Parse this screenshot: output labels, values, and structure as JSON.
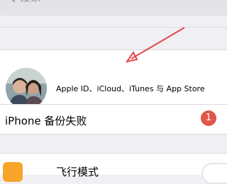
{
  "search": {
    "placeholder": "搜索"
  },
  "profile": {
    "name": "",
    "subtitle": "Apple ID、iCloud、iTunes 与 App Store"
  },
  "backup": {
    "label": "iPhone 备份失败",
    "badge_count": "1"
  },
  "airplane": {
    "label": "飞行模式",
    "toggle_on": false
  },
  "colors": {
    "background": "#efeff4",
    "badge": "#e0574a",
    "airplane_icon": "#f8a42a",
    "annotation_arrow": "#e34a4a"
  }
}
